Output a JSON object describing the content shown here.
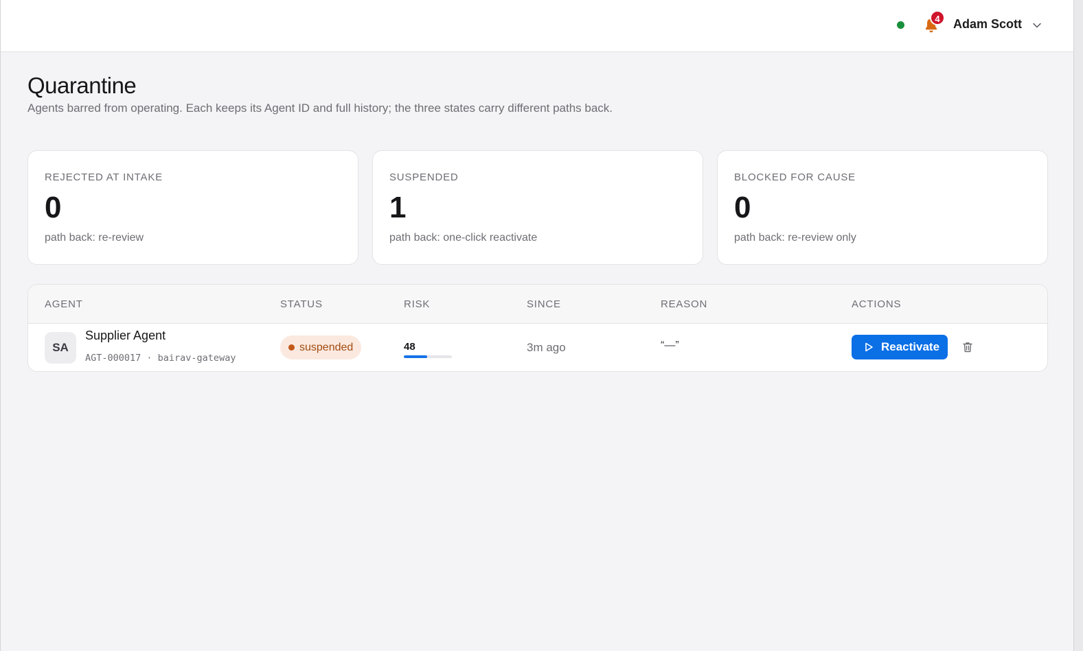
{
  "header": {
    "status_color": "#1a8f3c",
    "notifications_count": "4",
    "user_name": "Adam Scott",
    "icons": [
      "status-dot",
      "bell-icon",
      "chevron-down-icon"
    ]
  },
  "page": {
    "title": "Quarantine",
    "subtitle": "Agents barred from operating. Each keeps its Agent ID and full history; the three states carry different paths back."
  },
  "stats": [
    {
      "label": "REJECTED AT INTAKE",
      "value": "0",
      "note": "path back: re-review"
    },
    {
      "label": "SUSPENDED",
      "value": "1",
      "note": "path back: one-click reactivate"
    },
    {
      "label": "BLOCKED FOR CAUSE",
      "value": "0",
      "note": "path back: re-review only"
    }
  ],
  "table": {
    "columns": [
      "AGENT",
      "STATUS",
      "RISK",
      "SINCE",
      "REASON",
      "ACTIONS"
    ],
    "rows": [
      {
        "initials": "SA",
        "name": "Supplier Agent",
        "meta": "AGT-000017 · bairav-gateway",
        "status": "suspended",
        "risk": "48",
        "risk_fraction": 0.48,
        "since": "3m ago",
        "reason": "“—”",
        "action_label": "Reactivate"
      }
    ]
  },
  "colors": {
    "accent": "#0b6fe6",
    "suspended_bg": "#fbe9df",
    "suspended_text": "#a24b10",
    "badge": "#d0142c"
  }
}
